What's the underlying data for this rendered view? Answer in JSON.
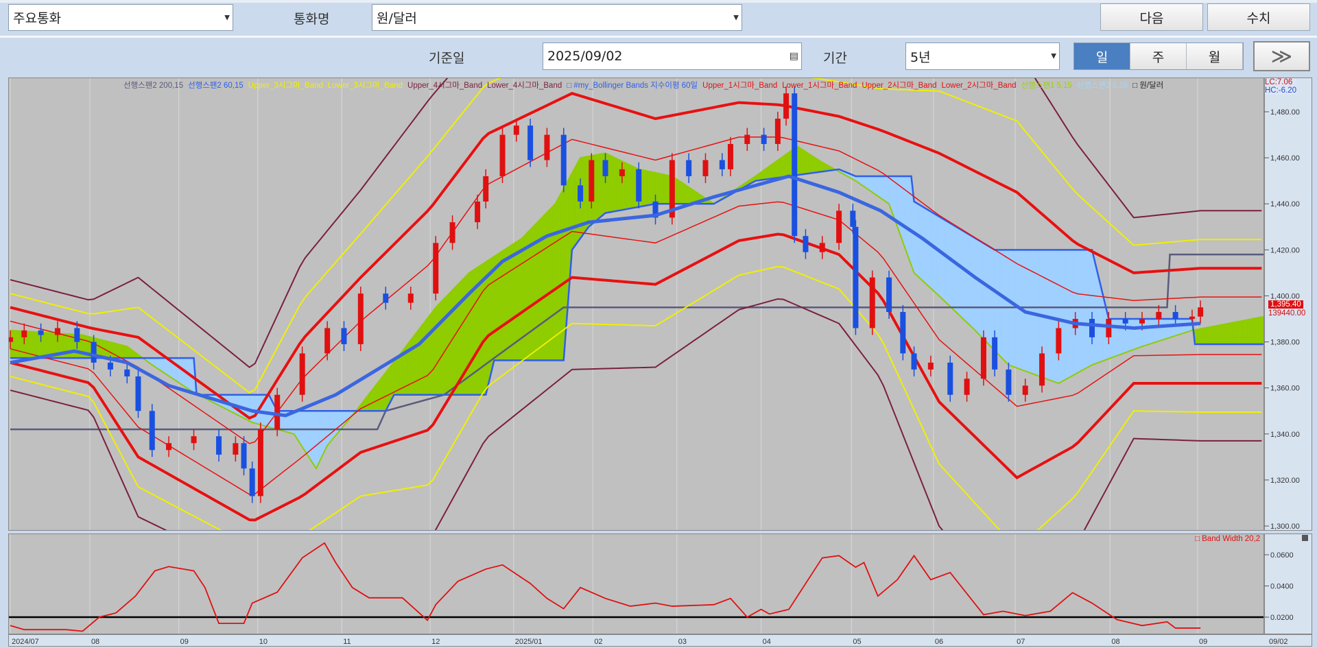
{
  "toolbar": {
    "category": "주요통화",
    "currency_label": "통화명",
    "currency": "원/달러",
    "next": "다음",
    "values": "수치",
    "date_label": "기준일",
    "date": "2025/09/02",
    "period_label": "기간",
    "period": "5년",
    "intervals": [
      "일",
      "주",
      "월"
    ],
    "active_interval": "일",
    "more": "≫"
  },
  "legend": [
    {
      "text": "선행스팬2 200,15",
      "color": "#5a5a7e"
    },
    {
      "text": "선행스팬2 60,15",
      "color": "#2f5fe8"
    },
    {
      "text": "Upper_3시그마_Band",
      "color": "#f0f000"
    },
    {
      "text": "Lower_3시그마_Band",
      "color": "#f0f000"
    },
    {
      "text": "Upper_4시그마_Band",
      "color": "#7a1f3d"
    },
    {
      "text": "Lower_4시그마_Band",
      "color": "#7a1f3d"
    },
    {
      "text": "□ #my_Bollinger Bands 지수이평 60일",
      "color": "#2f5fe8"
    },
    {
      "text": "Upper_1시그마_Band",
      "color": "#e01010"
    },
    {
      "text": "Lower_1시그마_Band",
      "color": "#e01010"
    },
    {
      "text": "Upper_2시그마_Band",
      "color": "#e01010"
    },
    {
      "text": "Lower_2시그마_Band",
      "color": "#e01010"
    },
    {
      "text": "선행스팬1 5,15",
      "color": "#9bd400"
    },
    {
      "text": "선행스팬2 5,15",
      "color": "#a8d4f8"
    },
    {
      "text": "□ 원/달러",
      "color": "#222222"
    }
  ],
  "info": {
    "lc": "LC:7.06",
    "hc": "HC:-6.20"
  },
  "last_price_label": "1,395.40",
  "last_value_label": "139440.00",
  "lower_legend": "□ Band Width 20,2",
  "chart_data": [
    {
      "type": "candlestick",
      "title": "원/달러",
      "ylim": [
        1296,
        1495
      ],
      "yticks": [
        "1,480.00",
        "1,460.00",
        "1,440.00",
        "1,420.00",
        "1,400.00",
        "1,380.00",
        "1,360.00",
        "1,340.00",
        "1,320.00",
        "1,300.00"
      ],
      "ytick_values": [
        1480,
        1460,
        1440,
        1420,
        1400,
        1380,
        1360,
        1340,
        1320,
        1300
      ],
      "x_unit": "trading day index from 2024/07",
      "xlim": [
        0,
        451
      ],
      "xticks": [
        {
          "d": 0,
          "label": "2024/07"
        },
        {
          "d": 28.6,
          "label": "08"
        },
        {
          "d": 60.6,
          "label": "09"
        },
        {
          "d": 89,
          "label": "10"
        },
        {
          "d": 119.2,
          "label": "11"
        },
        {
          "d": 151,
          "label": "12"
        },
        {
          "d": 181,
          "label": "2025/01"
        },
        {
          "d": 209.5,
          "label": "02"
        },
        {
          "d": 239.7,
          "label": "03"
        },
        {
          "d": 270,
          "label": "04"
        },
        {
          "d": 302.5,
          "label": "05"
        },
        {
          "d": 332,
          "label": "06"
        },
        {
          "d": 361.4,
          "label": "07"
        },
        {
          "d": 395.5,
          "label": "08"
        },
        {
          "d": 427,
          "label": "09"
        }
      ],
      "end_label": "09/02",
      "close": [
        [
          0,
          1382
        ],
        [
          5,
          1385
        ],
        [
          11,
          1383
        ],
        [
          17,
          1386
        ],
        [
          24,
          1380
        ],
        [
          30,
          1371
        ],
        [
          36,
          1368
        ],
        [
          42,
          1365
        ],
        [
          46,
          1350
        ],
        [
          51,
          1333
        ],
        [
          57,
          1336
        ],
        [
          66,
          1339
        ],
        [
          75,
          1331
        ],
        [
          81,
          1336
        ],
        [
          84,
          1325
        ],
        [
          87,
          1313
        ],
        [
          90,
          1342
        ],
        [
          96,
          1357
        ],
        [
          105,
          1375
        ],
        [
          114,
          1386
        ],
        [
          120,
          1379
        ],
        [
          126,
          1401
        ],
        [
          135,
          1397
        ],
        [
          144,
          1401
        ],
        [
          153,
          1423
        ],
        [
          159,
          1432
        ],
        [
          168,
          1441
        ],
        [
          171,
          1452
        ],
        [
          177,
          1470
        ],
        [
          182,
          1474
        ],
        [
          187,
          1459
        ],
        [
          193,
          1470
        ],
        [
          199,
          1448
        ],
        [
          205,
          1441
        ],
        [
          209,
          1459
        ],
        [
          214,
          1452
        ],
        [
          220,
          1455
        ],
        [
          226,
          1441
        ],
        [
          232,
          1434
        ],
        [
          238,
          1459
        ],
        [
          244,
          1452
        ],
        [
          250,
          1459
        ],
        [
          256,
          1455
        ],
        [
          259,
          1466
        ],
        [
          265,
          1470
        ],
        [
          271,
          1466
        ],
        [
          276,
          1477
        ],
        [
          279,
          1488
        ],
        [
          282,
          1426
        ],
        [
          286,
          1419
        ],
        [
          292,
          1423
        ],
        [
          298,
          1437
        ],
        [
          303,
          1430
        ],
        [
          304,
          1386
        ],
        [
          310,
          1408
        ],
        [
          316,
          1393
        ],
        [
          321,
          1375
        ],
        [
          325,
          1368
        ],
        [
          331,
          1371
        ],
        [
          338,
          1357
        ],
        [
          344,
          1364
        ],
        [
          350,
          1382
        ],
        [
          354,
          1368
        ],
        [
          359,
          1357
        ],
        [
          365,
          1361
        ],
        [
          371,
          1375
        ],
        [
          377,
          1386
        ],
        [
          383,
          1390
        ],
        [
          389,
          1382
        ],
        [
          395,
          1390
        ],
        [
          401,
          1388
        ],
        [
          407,
          1390
        ],
        [
          413,
          1393
        ],
        [
          419,
          1390
        ],
        [
          425,
          1391
        ],
        [
          428,
          1395
        ]
      ],
      "bollinger_mid_sigma": [
        [
          0,
          1383,
          6
        ],
        [
          29,
          1374,
          6
        ],
        [
          46,
          1356,
          13
        ],
        [
          87,
          1324,
          11
        ],
        [
          105,
          1347,
          17
        ],
        [
          126,
          1370,
          19
        ],
        [
          151,
          1390,
          24
        ],
        [
          171,
          1426,
          22
        ],
        [
          202,
          1448,
          20
        ],
        [
          232,
          1441,
          18
        ],
        [
          262,
          1454,
          15
        ],
        [
          277,
          1455,
          14
        ],
        [
          298,
          1448,
          15
        ],
        [
          313,
          1436,
          18
        ],
        [
          334,
          1408,
          27
        ],
        [
          362,
          1383,
          31
        ],
        [
          383,
          1379,
          22
        ],
        [
          404,
          1386,
          12
        ],
        [
          428,
          1387,
          12.5
        ]
      ],
      "ema60": [
        [
          0,
          1371
        ],
        [
          23,
          1376
        ],
        [
          42,
          1371
        ],
        [
          57,
          1361
        ],
        [
          87,
          1350
        ],
        [
          99,
          1348
        ],
        [
          117,
          1357
        ],
        [
          132,
          1368
        ],
        [
          147,
          1379
        ],
        [
          165,
          1401
        ],
        [
          177,
          1415
        ],
        [
          193,
          1426
        ],
        [
          208,
          1432
        ],
        [
          232,
          1435
        ],
        [
          253,
          1443
        ],
        [
          268,
          1448
        ],
        [
          280,
          1452
        ],
        [
          298,
          1445
        ],
        [
          313,
          1437
        ],
        [
          328,
          1425
        ],
        [
          347,
          1408
        ],
        [
          365,
          1393
        ],
        [
          383,
          1388
        ],
        [
          404,
          1386
        ],
        [
          428,
          1388
        ]
      ],
      "span1": [
        [
          0,
          1385
        ],
        [
          26,
          1383
        ],
        [
          42,
          1378
        ],
        [
          51,
          1370
        ],
        [
          66,
          1358
        ],
        [
          87,
          1345
        ],
        [
          102,
          1340
        ],
        [
          110,
          1325
        ],
        [
          114,
          1335
        ],
        [
          123,
          1348
        ],
        [
          141,
          1376
        ],
        [
          153,
          1395
        ],
        [
          165,
          1410
        ],
        [
          184,
          1425
        ],
        [
          196,
          1440
        ],
        [
          205,
          1460
        ],
        [
          214,
          1462
        ],
        [
          226,
          1455
        ],
        [
          238,
          1452
        ],
        [
          253,
          1440
        ],
        [
          268,
          1452
        ],
        [
          283,
          1465
        ],
        [
          292,
          1458
        ],
        [
          304,
          1450
        ],
        [
          316,
          1440
        ],
        [
          325,
          1410
        ],
        [
          334,
          1400
        ],
        [
          347,
          1385
        ],
        [
          359,
          1370
        ],
        [
          377,
          1362
        ],
        [
          389,
          1370
        ],
        [
          407,
          1378
        ],
        [
          425,
          1385
        ],
        [
          451,
          1391
        ]
      ],
      "span2_60": [
        [
          0,
          1373
        ],
        [
          66,
          1373
        ],
        [
          67,
          1357
        ],
        [
          93,
          1357
        ],
        [
          96,
          1350
        ],
        [
          135,
          1350
        ],
        [
          138,
          1357
        ],
        [
          171,
          1357
        ],
        [
          174,
          1372
        ],
        [
          199,
          1372
        ],
        [
          202,
          1420
        ],
        [
          208,
          1430
        ],
        [
          214,
          1436
        ],
        [
          232,
          1440
        ],
        [
          253,
          1440
        ],
        [
          268,
          1450
        ],
        [
          298,
          1455
        ],
        [
          304,
          1452
        ],
        [
          324,
          1452
        ],
        [
          325,
          1441
        ],
        [
          354,
          1420
        ],
        [
          389,
          1420
        ],
        [
          395,
          1390
        ],
        [
          425,
          1390
        ],
        [
          426,
          1379
        ],
        [
          451,
          1379
        ]
      ],
      "span2_200": [
        [
          0,
          1342
        ],
        [
          132,
          1342
        ],
        [
          135,
          1350
        ],
        [
          156,
          1357
        ],
        [
          174,
          1373
        ],
        [
          199,
          1395
        ],
        [
          416,
          1395
        ],
        [
          417,
          1418
        ],
        [
          451,
          1418
        ]
      ]
    },
    {
      "type": "line",
      "title": "Band Width 20,2",
      "ylim": [
        0.008,
        0.075
      ],
      "yticks": [
        "0.0600",
        "0.0400",
        "0.0200"
      ],
      "ytick_values": [
        0.06,
        0.04,
        0.02
      ],
      "reference_line": 0.02,
      "series": [
        [
          0,
          0.0146
        ],
        [
          5,
          0.012
        ],
        [
          20,
          0.012
        ],
        [
          26,
          0.011
        ],
        [
          32,
          0.02
        ],
        [
          38,
          0.0227
        ],
        [
          45,
          0.0335
        ],
        [
          52,
          0.0497
        ],
        [
          57,
          0.0524
        ],
        [
          66,
          0.0497
        ],
        [
          70,
          0.039
        ],
        [
          75,
          0.016
        ],
        [
          84,
          0.016
        ],
        [
          87,
          0.029
        ],
        [
          96,
          0.036
        ],
        [
          105,
          0.058
        ],
        [
          113,
          0.0675
        ],
        [
          117,
          0.055
        ],
        [
          123,
          0.039
        ],
        [
          129,
          0.0324
        ],
        [
          141,
          0.0324
        ],
        [
          150,
          0.018
        ],
        [
          153,
          0.028
        ],
        [
          161,
          0.043
        ],
        [
          171,
          0.0508
        ],
        [
          177,
          0.0535
        ],
        [
          187,
          0.0416
        ],
        [
          193,
          0.032
        ],
        [
          199,
          0.0254
        ],
        [
          205,
          0.039
        ],
        [
          214,
          0.032
        ],
        [
          223,
          0.027
        ],
        [
          232,
          0.029
        ],
        [
          238,
          0.027
        ],
        [
          253,
          0.028
        ],
        [
          259,
          0.032
        ],
        [
          265,
          0.02
        ],
        [
          270,
          0.025
        ],
        [
          273,
          0.022
        ],
        [
          280,
          0.025
        ],
        [
          292,
          0.058
        ],
        [
          298,
          0.0594
        ],
        [
          304,
          0.052
        ],
        [
          307,
          0.055
        ],
        [
          312,
          0.0335
        ],
        [
          319,
          0.044
        ],
        [
          325,
          0.0594
        ],
        [
          331,
          0.044
        ],
        [
          338,
          0.0486
        ],
        [
          350,
          0.0216
        ],
        [
          357,
          0.0238
        ],
        [
          365,
          0.021
        ],
        [
          374,
          0.0238
        ],
        [
          382,
          0.0357
        ],
        [
          389,
          0.029
        ],
        [
          398,
          0.0184
        ],
        [
          407,
          0.0146
        ],
        [
          416,
          0.017
        ],
        [
          419,
          0.013
        ],
        [
          428,
          0.013
        ]
      ]
    }
  ]
}
